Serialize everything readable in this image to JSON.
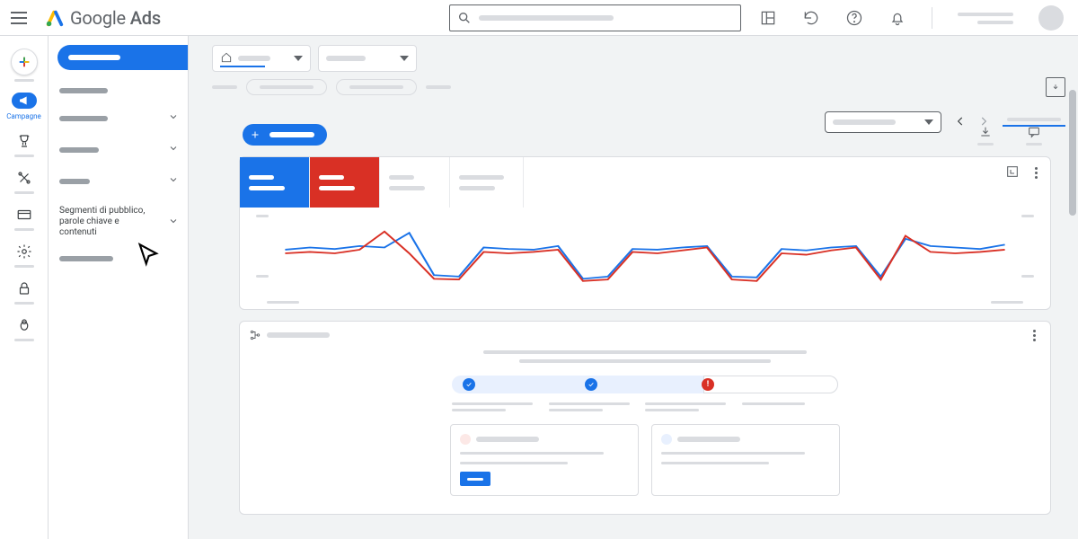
{
  "brand": {
    "name_regular": "Google",
    "name_bold": "Ads"
  },
  "rail": {
    "campaigns_label": "Campagne"
  },
  "nav2": {
    "audiences_label": "Segmenti di pubblico, parole chiave e contenuti"
  },
  "colors": {
    "blue": "#1a73e8",
    "red": "#d93025",
    "grey": "#dadce0"
  },
  "chart_data": {
    "type": "line",
    "title": "",
    "xlabel": "",
    "ylabel": "",
    "x": [
      0,
      1,
      2,
      3,
      4,
      5,
      6,
      7,
      8,
      9,
      10,
      11,
      12,
      13,
      14,
      15,
      16,
      17,
      18,
      19,
      20,
      21,
      22,
      23,
      24,
      25,
      26,
      27,
      28,
      29
    ],
    "series": [
      {
        "name": "metric_blue",
        "color": "#1a73e8",
        "values": [
          55,
          58,
          56,
          60,
          58,
          78,
          20,
          18,
          58,
          56,
          55,
          60,
          15,
          18,
          56,
          55,
          58,
          60,
          18,
          17,
          56,
          54,
          58,
          60,
          18,
          70,
          60,
          58,
          56,
          62
        ]
      },
      {
        "name": "metric_red",
        "color": "#d93025",
        "values": [
          50,
          52,
          50,
          55,
          80,
          50,
          15,
          14,
          52,
          50,
          52,
          55,
          12,
          14,
          52,
          50,
          54,
          58,
          14,
          12,
          50,
          48,
          54,
          58,
          14,
          74,
          52,
          50,
          52,
          55
        ]
      }
    ],
    "ylim_left": [
      0,
      100
    ],
    "ylim_right": [
      0,
      100
    ]
  },
  "stepper": {
    "steps": [
      {
        "status": "ok"
      },
      {
        "status": "ok"
      },
      {
        "status": "error"
      },
      {
        "status": "pending"
      }
    ]
  }
}
